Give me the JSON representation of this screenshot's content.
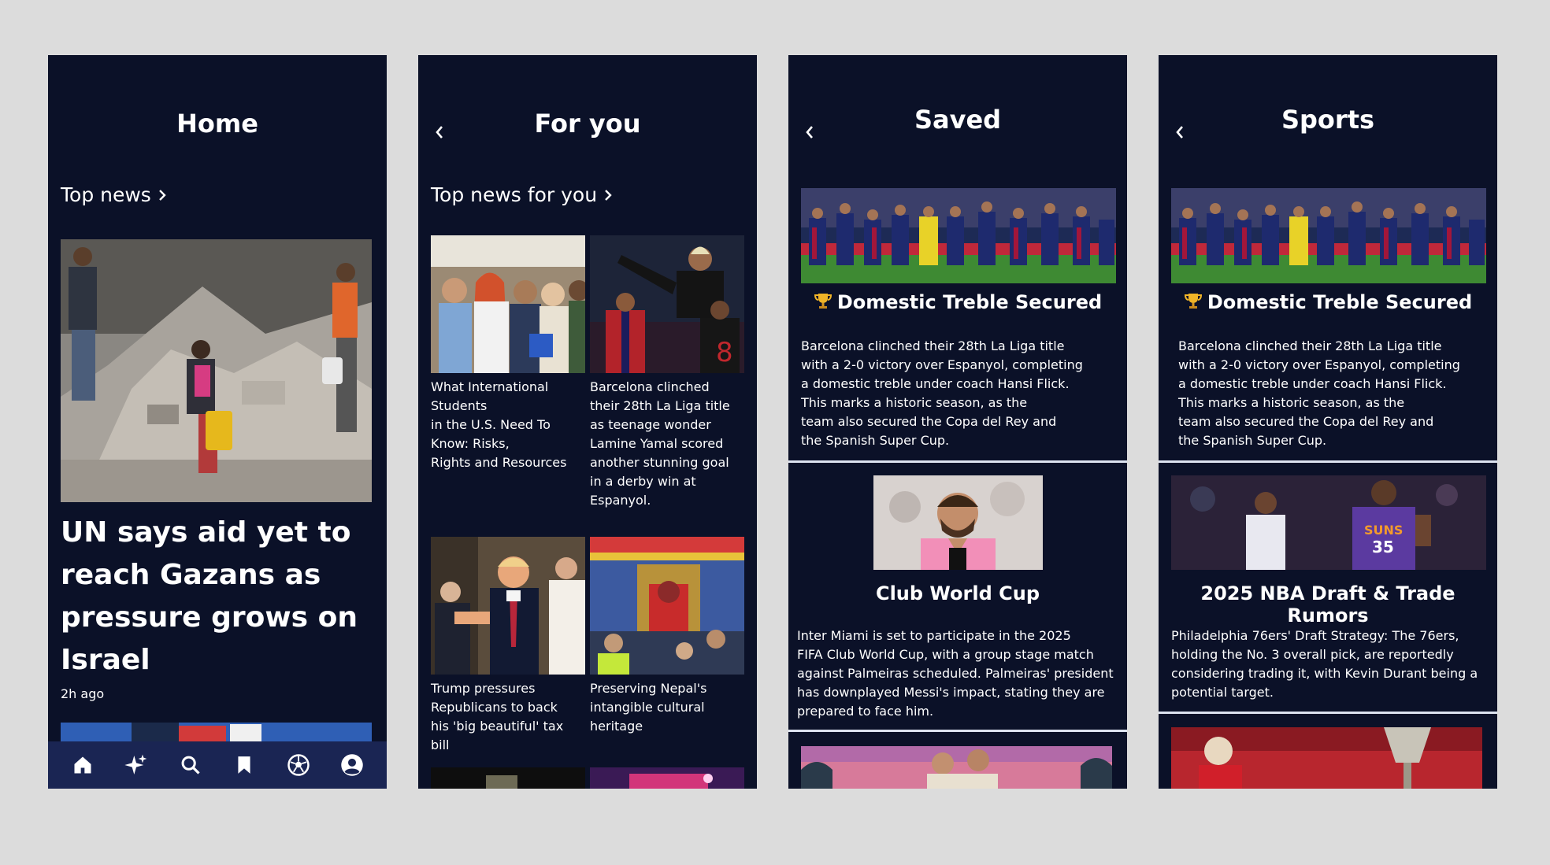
{
  "screens": {
    "home": {
      "title": "Home",
      "section_link": "Top news",
      "hero": {
        "headline": "UN says aid yet to reach Gazans as pressure grows on Israel",
        "time": "2h ago"
      },
      "nav": [
        "home-icon",
        "sparkles-icon",
        "search-icon",
        "bookmark-icon",
        "soccer-ball-icon",
        "profile-icon"
      ]
    },
    "for_you": {
      "title": "For you",
      "section_link": "Top news for you",
      "tiles": [
        {
          "caption": "What International\nStudents\nin the U.S. Need To\nKnow: Risks,\n Rights and Resources"
        },
        {
          "caption": "Barcelona clinched\ntheir 28th La Liga title\nas teenage wonder\nLamine Yamal scored\nanother stunning goal\nin a derby win at\nEspanyol."
        },
        {
          "caption": "Trump pressures\nRepublicans to back\n his 'big beautiful' tax\nbill"
        },
        {
          "caption": "Preserving Nepal's\nintangible cultural\nheritage"
        }
      ]
    },
    "saved": {
      "title": "Saved",
      "cards": [
        {
          "title": "Domestic Treble Secured",
          "icon": "trophy-icon",
          "body": "Barcelona clinched their 28th La Liga title\nwith a 2-0 victory over Espanyol, completing\na domestic treble under coach Hansi Flick.\nThis marks a historic season, as the\nteam also secured the Copa del Rey and\nthe Spanish Super Cup."
        },
        {
          "title": "Club World Cup",
          "body": "Inter Miami is set to participate in the 2025\nFIFA Club World Cup, with a group stage match\nagainst Palmeiras scheduled. Palmeiras' president\nhas downplayed Messi's impact, stating they are\nprepared to face him."
        }
      ]
    },
    "sports": {
      "title": "Sports",
      "cards": [
        {
          "title": "Domestic Treble Secured",
          "icon": "trophy-icon",
          "body": "Barcelona clinched their 28th La Liga title\nwith a 2-0 victory over Espanyol, completing\na domestic treble under coach Hansi Flick.\nThis marks a historic season, as the\nteam also secured the Copa del Rey and\nthe Spanish Super Cup."
        },
        {
          "title": "2025 NBA Draft & Trade Rumors",
          "body": "Philadelphia 76ers' Draft Strategy: The 76ers,\nholding the No. 3 overall pick, are reportedly\nconsidering trading it, with Kevin Durant being a\npotential target."
        }
      ]
    }
  },
  "colors": {
    "background": "#dcdcdc",
    "screen": "#0b1128",
    "nav": "#1a2553",
    "divider": "#dde3f0"
  }
}
